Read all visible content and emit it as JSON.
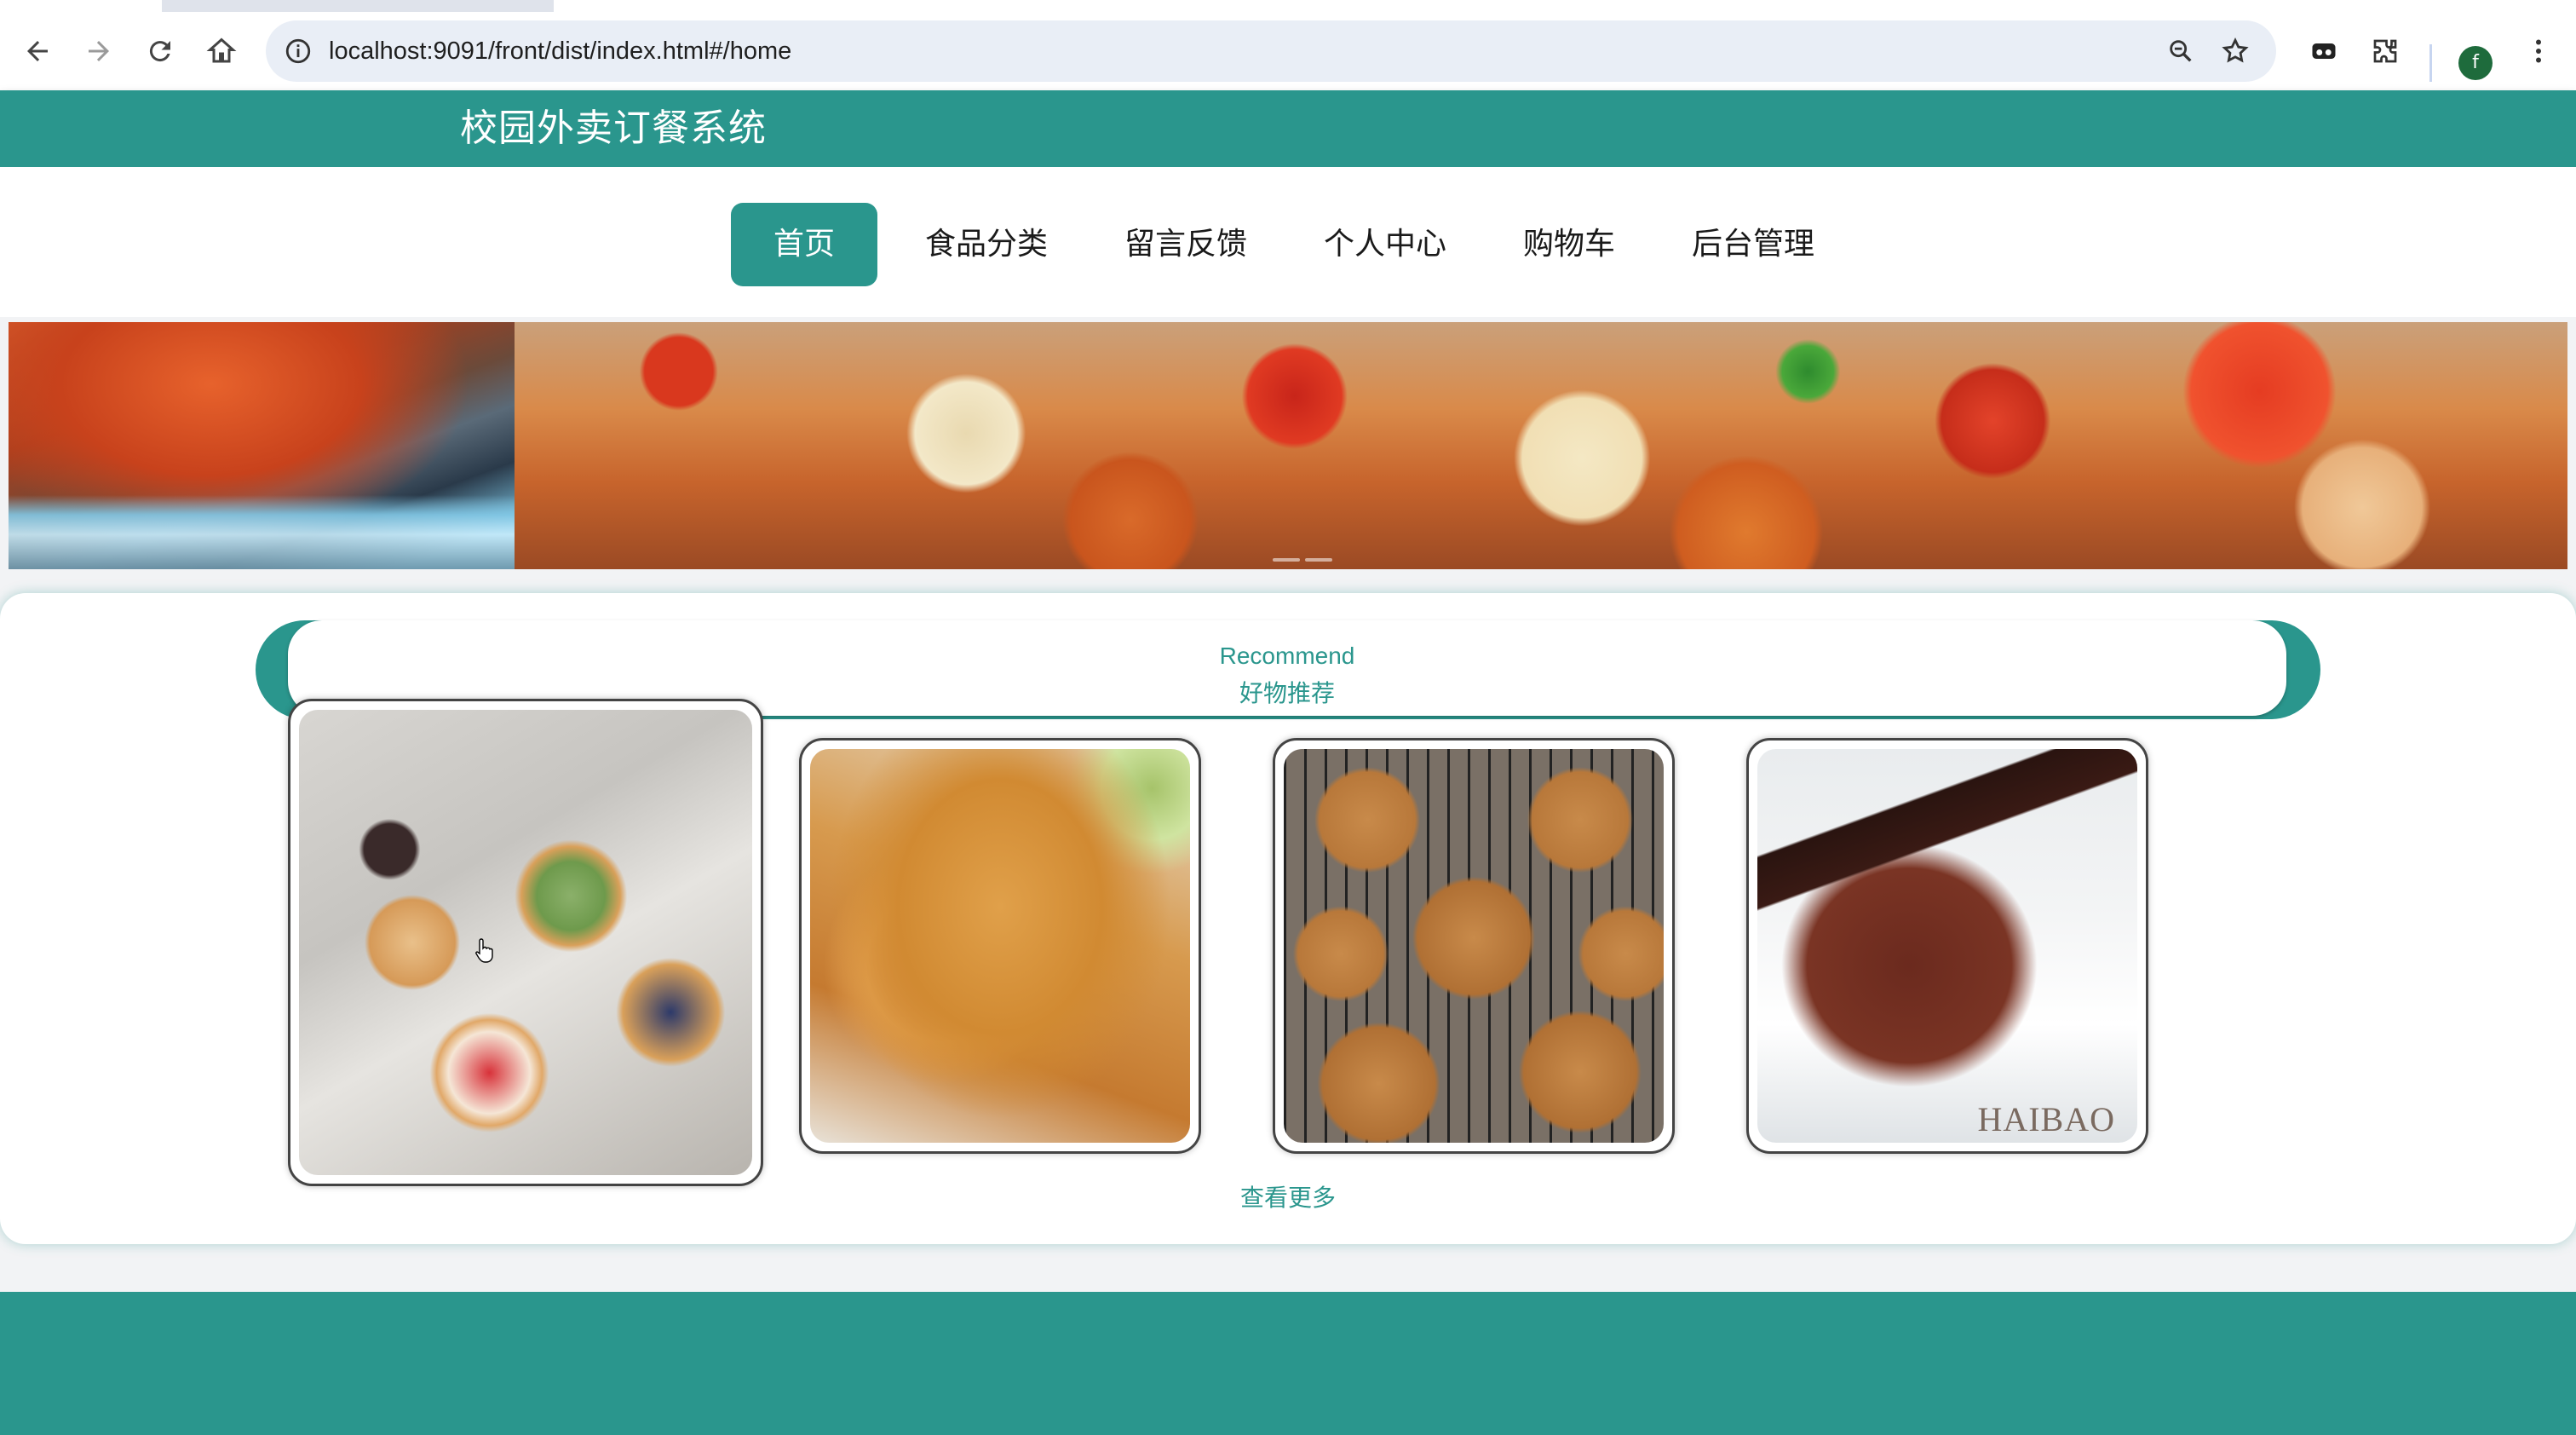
{
  "browser": {
    "url": "localhost:9091/front/dist/index.html#/home",
    "profile_initial": "f"
  },
  "site": {
    "title": "校园外卖订餐系统"
  },
  "nav": {
    "items": [
      {
        "label": "首页",
        "active": true
      },
      {
        "label": "食品分类",
        "active": false
      },
      {
        "label": "留言反馈",
        "active": false
      },
      {
        "label": "个人中心",
        "active": false
      },
      {
        "label": "购物车",
        "active": false
      },
      {
        "label": "后台管理",
        "active": false
      }
    ]
  },
  "recommend": {
    "title_en": "Recommend",
    "title_cn": "好物推荐",
    "cards": [
      {
        "image": "cream puff pastries"
      },
      {
        "image": "fried chicken"
      },
      {
        "image": "cookies on cooling rack"
      },
      {
        "image": "chocolate cake slice",
        "watermark": "HAIBAO"
      }
    ],
    "more_label": "查看更多"
  },
  "colors": {
    "accent": "#2a968d",
    "header_text": "#ffffff"
  }
}
